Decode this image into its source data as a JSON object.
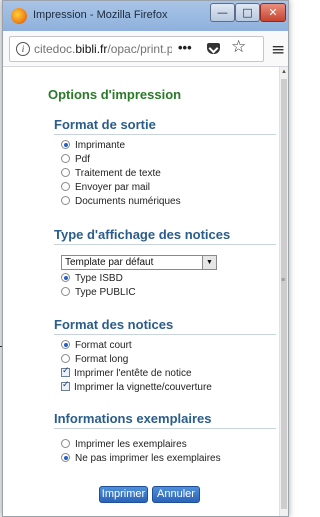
{
  "window": {
    "title": "Impression - Mozilla Firefox",
    "min_label": "—",
    "max_label": "□",
    "close_label": "✕"
  },
  "urlbar": {
    "url_domain": "citedoc.",
    "url_host": "bibli.fr",
    "url_path": "/opac/print.php",
    "more_label": "•••",
    "star_glyph": "☆",
    "menu_glyph": "≡",
    "info_glyph": "i"
  },
  "page": {
    "options_title": "Options d'impression",
    "format_sortie": {
      "title": "Format de sortie",
      "options": [
        "Imprimante",
        "Pdf",
        "Traitement de texte",
        "Envoyer par mail",
        "Documents numériques"
      ],
      "selected": "Imprimante"
    },
    "affichage": {
      "title": "Type d'affichage des notices",
      "select_value": "Template par défaut",
      "options": [
        "Type ISBD",
        "Type PUBLIC"
      ],
      "selected": "Type ISBD"
    },
    "format_notices": {
      "title": "Format des notices",
      "radio_options": [
        "Format court",
        "Format long"
      ],
      "selected": "Format court",
      "checkboxes": [
        "Imprimer l'entête de notice",
        "Imprimer la vignette/couverture"
      ]
    },
    "exemplaires": {
      "title": "Informations exemplaires",
      "options": [
        "Imprimer les exemplaires",
        "Ne pas imprimer les exemplaires"
      ],
      "selected": "Ne pas imprimer les exemplaires"
    },
    "buttons": {
      "print": "Imprimer",
      "cancel": "Annuler"
    }
  },
  "colors": {
    "options_title": "#2a7a2a",
    "section_title": "#2a5d8a",
    "button": "#2a63b8",
    "titlebar": "#a8c4e6"
  }
}
